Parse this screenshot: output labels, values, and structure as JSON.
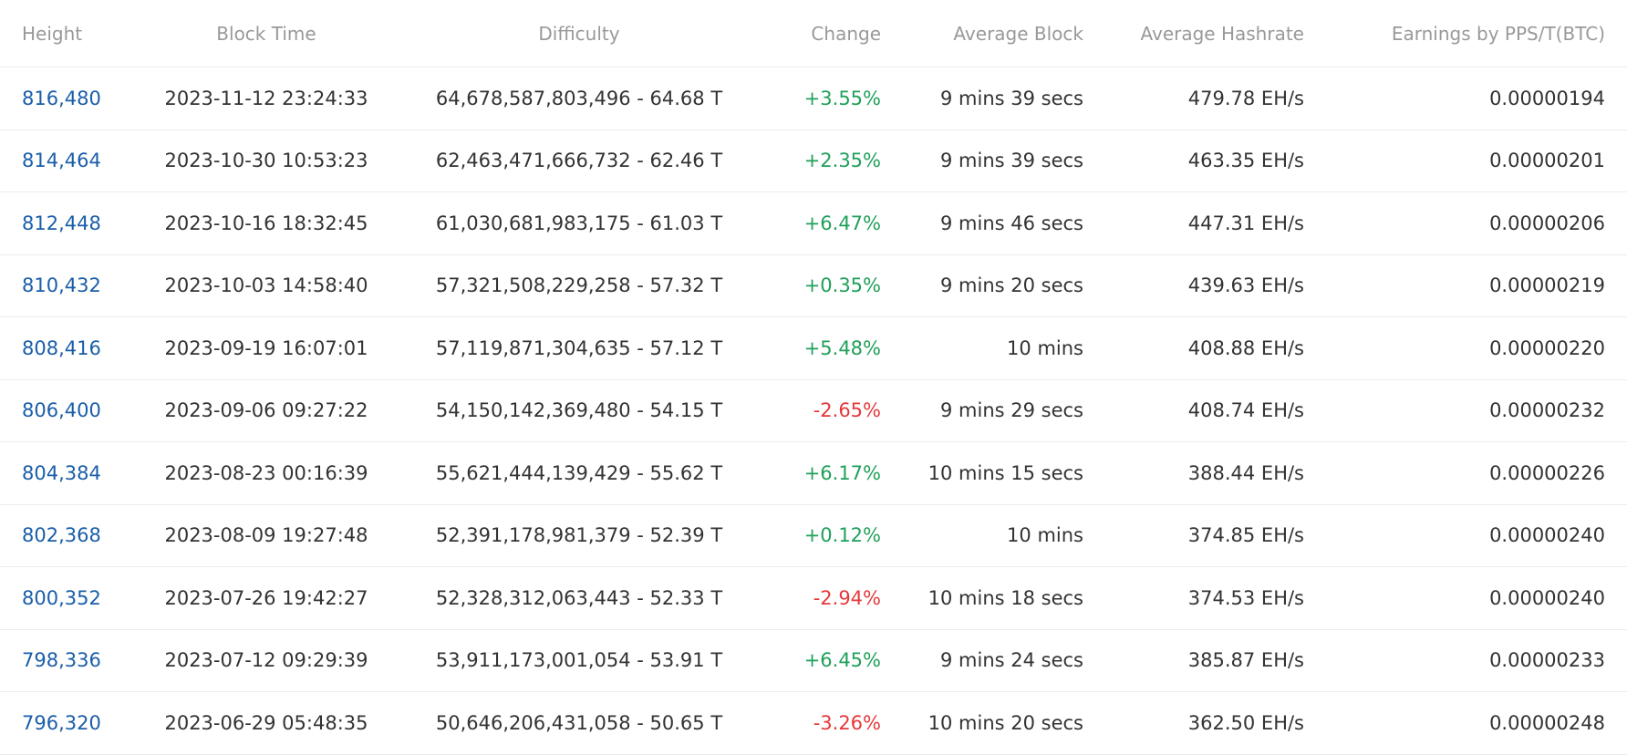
{
  "columns": {
    "height": "Height",
    "block_time": "Block Time",
    "difficulty": "Difficulty",
    "change": "Change",
    "average_block": "Average Block",
    "average_hashrate": "Average Hashrate",
    "earnings": "Earnings by PPS/T(BTC)"
  },
  "rows": [
    {
      "height": "816,480",
      "time": "2023-11-12 23:24:33",
      "difficulty": "64,678,587,803,496 - 64.68 T",
      "change": "+3.55%",
      "avg_block": "9 mins 39 secs",
      "hashrate": "479.78 EH/s",
      "earnings": "0.00000194"
    },
    {
      "height": "814,464",
      "time": "2023-10-30 10:53:23",
      "difficulty": "62,463,471,666,732 - 62.46 T",
      "change": "+2.35%",
      "avg_block": "9 mins 39 secs",
      "hashrate": "463.35 EH/s",
      "earnings": "0.00000201"
    },
    {
      "height": "812,448",
      "time": "2023-10-16 18:32:45",
      "difficulty": "61,030,681,983,175 - 61.03 T",
      "change": "+6.47%",
      "avg_block": "9 mins 46 secs",
      "hashrate": "447.31 EH/s",
      "earnings": "0.00000206"
    },
    {
      "height": "810,432",
      "time": "2023-10-03 14:58:40",
      "difficulty": "57,321,508,229,258 - 57.32 T",
      "change": "+0.35%",
      "avg_block": "9 mins 20 secs",
      "hashrate": "439.63 EH/s",
      "earnings": "0.00000219"
    },
    {
      "height": "808,416",
      "time": "2023-09-19 16:07:01",
      "difficulty": "57,119,871,304,635 - 57.12 T",
      "change": "+5.48%",
      "avg_block": "10 mins",
      "hashrate": "408.88 EH/s",
      "earnings": "0.00000220"
    },
    {
      "height": "806,400",
      "time": "2023-09-06 09:27:22",
      "difficulty": "54,150,142,369,480 - 54.15 T",
      "change": "-2.65%",
      "avg_block": "9 mins 29 secs",
      "hashrate": "408.74 EH/s",
      "earnings": "0.00000232"
    },
    {
      "height": "804,384",
      "time": "2023-08-23 00:16:39",
      "difficulty": "55,621,444,139,429 - 55.62 T",
      "change": "+6.17%",
      "avg_block": "10 mins 15 secs",
      "hashrate": "388.44 EH/s",
      "earnings": "0.00000226"
    },
    {
      "height": "802,368",
      "time": "2023-08-09 19:27:48",
      "difficulty": "52,391,178,981,379 - 52.39 T",
      "change": "+0.12%",
      "avg_block": "10 mins",
      "hashrate": "374.85 EH/s",
      "earnings": "0.00000240"
    },
    {
      "height": "800,352",
      "time": "2023-07-26 19:42:27",
      "difficulty": "52,328,312,063,443 - 52.33 T",
      "change": "-2.94%",
      "avg_block": "10 mins 18 secs",
      "hashrate": "374.53 EH/s",
      "earnings": "0.00000240"
    },
    {
      "height": "798,336",
      "time": "2023-07-12 09:29:39",
      "difficulty": "53,911,173,001,054 - 53.91 T",
      "change": "+6.45%",
      "avg_block": "9 mins 24 secs",
      "hashrate": "385.87 EH/s",
      "earnings": "0.00000233"
    },
    {
      "height": "796,320",
      "time": "2023-06-29 05:48:35",
      "difficulty": "50,646,206,431,058 - 50.65 T",
      "change": "-3.26%",
      "avg_block": "10 mins 20 secs",
      "hashrate": "362.50 EH/s",
      "earnings": "0.00000248"
    }
  ],
  "colors": {
    "link": "#1a5ea8",
    "positive": "#20a05a",
    "negative": "#e5393b",
    "header_text": "#999999"
  }
}
